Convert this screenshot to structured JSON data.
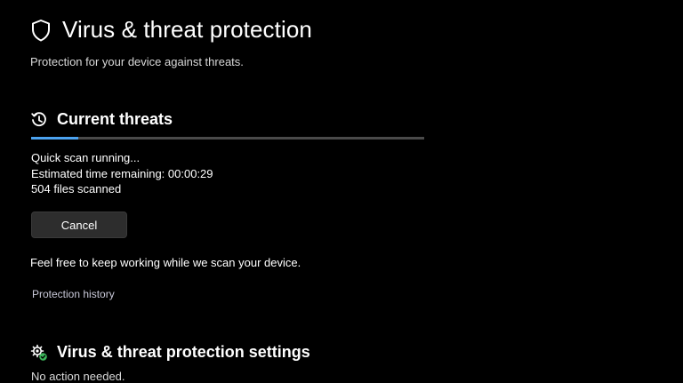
{
  "page": {
    "title": "Virus & threat protection",
    "subtitle": "Protection for your device against threats.",
    "icon": "shield-icon"
  },
  "current_threats": {
    "title": "Current threats",
    "icon": "scan-clock-icon",
    "progress_fraction": 0.12,
    "status_line": "Quick scan running...",
    "time_remaining_label": "Estimated time remaining:",
    "time_remaining_value": "00:00:29",
    "files_scanned_count": "504",
    "files_scanned_label": "files scanned",
    "cancel_label": "Cancel",
    "info_text": "Feel free to keep working while we scan your device.",
    "history_link": "Protection history"
  },
  "settings": {
    "title": "Virus & threat protection settings",
    "icon": "settings-gear-check-icon",
    "status": "No action needed."
  },
  "colors": {
    "background": "#000000",
    "accent": "#4ca3f0",
    "status_ok": "#3cb55a"
  }
}
